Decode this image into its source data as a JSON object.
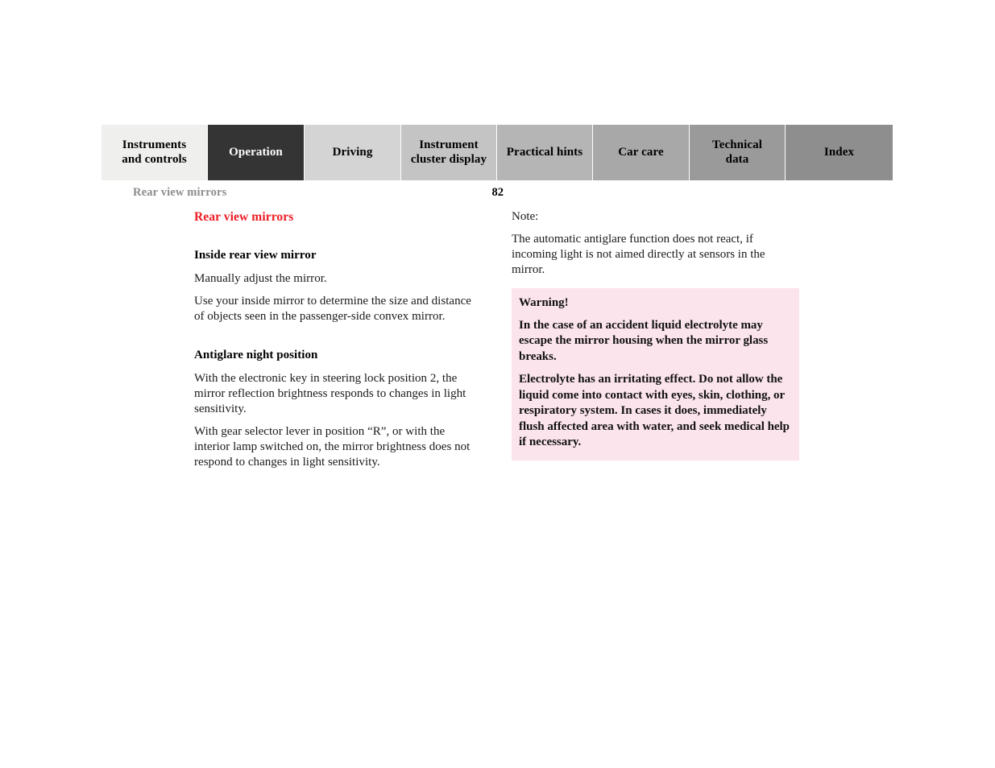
{
  "document": {
    "running_head": "Rear view mirrors",
    "page_number": "82"
  },
  "tabs": [
    {
      "label": "Instruments and controls",
      "line1": "Instruments",
      "line2": "and controls",
      "color": "#efefee",
      "active": false
    },
    {
      "label": "Operation",
      "line1": "Operation",
      "line2": "",
      "color": "#343434",
      "active": true
    },
    {
      "label": "Driving",
      "line1": "Driving",
      "line2": "",
      "color": "#d4d4d4",
      "active": false
    },
    {
      "label": "Instrument cluster display",
      "line1": "Instrument",
      "line2": "cluster display",
      "color": "#c4c4c4",
      "active": false
    },
    {
      "label": "Practical hints",
      "line1": "Practical hints",
      "line2": "",
      "color": "#b5b5b5",
      "active": false
    },
    {
      "label": "Car care",
      "line1": "Car care",
      "line2": "",
      "color": "#a8a8a8",
      "active": false
    },
    {
      "label": "Technical data",
      "line1": "Technical",
      "line2": "data",
      "color": "#9a9a9a",
      "active": false
    },
    {
      "label": "Index",
      "line1": "Index",
      "line2": "",
      "color": "#8e8e8e",
      "active": false
    }
  ],
  "left_column": {
    "section_title": "Rear view mirrors",
    "subhead_1": "Inside rear view mirror",
    "para_1": "Manually adjust the mirror.",
    "para_2": "Use your inside mirror to determine the size and distance of objects seen in the passenger-side convex mirror.",
    "subhead_2": "Antiglare night position",
    "para_3": "With the electronic key in steering lock position 2, the mirror reflection brightness responds to changes in light sensitivity.",
    "para_4": "With gear selector lever in position “R”, or with the interior lamp switched on, the mirror brightness does not respond to changes in light sensitivity."
  },
  "right_column": {
    "note_label": "Note:",
    "note_body": "The automatic antiglare function does not react, if incoming light is not aimed directly at sensors in the mirror.",
    "warning": {
      "title": "Warning!",
      "para_1": "In the case of an accident liquid electrolyte may escape the mirror housing when the mirror glass breaks.",
      "para_2": "Electrolyte has an irritating effect. Do not allow the liquid come into contact with eyes, skin, clothing, or respiratory system. In cases it does, immediately flush affected area with water, and seek medical help if necessary.",
      "background_color": "#fce4ec"
    }
  },
  "colors": {
    "accent_red": "#ec1c24",
    "running_head_gray": "#8d8d8d",
    "active_tab": "#343434"
  }
}
